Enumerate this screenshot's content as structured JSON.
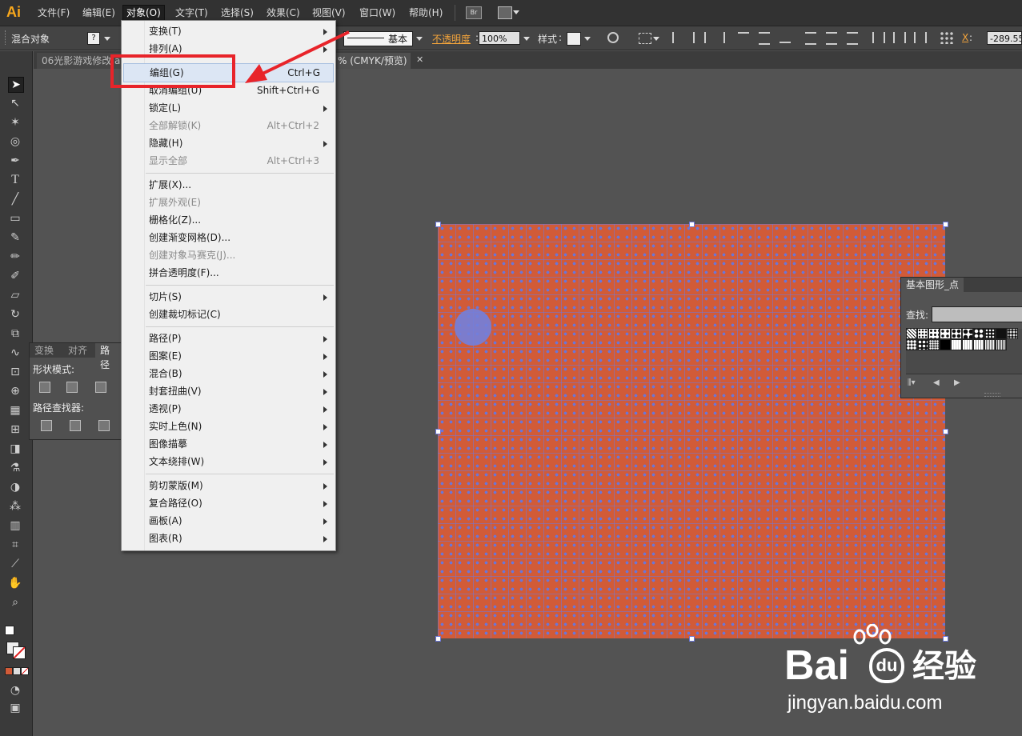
{
  "app": {
    "logo": "Ai"
  },
  "menubar": {
    "items": [
      "文件(F)",
      "编辑(E)",
      "对象(O)",
      "文字(T)",
      "选择(S)",
      "效果(C)",
      "视图(V)",
      "窗口(W)",
      "帮助(H)"
    ],
    "bridge": "Br"
  },
  "controlbar": {
    "object_label": "混合对象",
    "fill_value": "?",
    "stroke_style": "基本",
    "opacity_label": "不透明度",
    "opacity_value": "100%",
    "style_label": "样式",
    "x_label": "X",
    "x_value": "-289.55"
  },
  "tabs": {
    "doc1": "06光影游戏修改",
    "doc2_prefix": "a",
    "doc2_suffix": "% (CMYK/预览)",
    "close": "✕"
  },
  "pathfinder": {
    "tabs": [
      "变换",
      "对齐",
      "路径"
    ],
    "shape_modes": "形状模式:",
    "pathfinders": "路径查找器:"
  },
  "swatches": {
    "title": "基本图形_点",
    "search_label": "查找:"
  },
  "object_menu": {
    "items": [
      {
        "label": "变换(T)",
        "arrow": true
      },
      {
        "label": "排列(A)",
        "arrow": true
      },
      {
        "label": "编组(G)",
        "shortcut": "Ctrl+G",
        "highlight": true
      },
      {
        "label": "取消编组(U)",
        "shortcut": "Shift+Ctrl+G"
      },
      {
        "label": "锁定(L)",
        "arrow": true
      },
      {
        "label": "全部解锁(K)",
        "shortcut": "Alt+Ctrl+2",
        "disabled": true
      },
      {
        "label": "隐藏(H)",
        "arrow": true
      },
      {
        "label": "显示全部",
        "shortcut": "Alt+Ctrl+3",
        "disabled": true
      },
      {
        "label": "扩展(X)..."
      },
      {
        "label": "扩展外观(E)",
        "disabled": true
      },
      {
        "label": "栅格化(Z)..."
      },
      {
        "label": "创建渐变网格(D)..."
      },
      {
        "label": "创建对象马赛克(J)...",
        "disabled": true
      },
      {
        "label": "拼合透明度(F)..."
      },
      {
        "label": "切片(S)",
        "arrow": true
      },
      {
        "label": "创建裁切标记(C)"
      },
      {
        "label": "路径(P)",
        "arrow": true
      },
      {
        "label": "图案(E)",
        "arrow": true
      },
      {
        "label": "混合(B)",
        "arrow": true
      },
      {
        "label": "封套扭曲(V)",
        "arrow": true
      },
      {
        "label": "透视(P)",
        "arrow": true
      },
      {
        "label": "实时上色(N)",
        "arrow": true
      },
      {
        "label": "图像描摹",
        "arrow": true
      },
      {
        "label": "文本绕排(W)",
        "arrow": true
      },
      {
        "label": "剪切蒙版(M)",
        "arrow": true
      },
      {
        "label": "复合路径(O)",
        "arrow": true
      },
      {
        "label": "画板(A)",
        "arrow": true
      },
      {
        "label": "图表(R)",
        "arrow": true
      }
    ]
  },
  "watermark": {
    "brand": "Bai",
    "brand2": "du",
    "brand_cn": "经验",
    "url": "jingyan.baidu.com"
  },
  "colors": {
    "accent_red": "#e8242a",
    "artwork": "#d15b38",
    "grid": "#6a76d8"
  }
}
